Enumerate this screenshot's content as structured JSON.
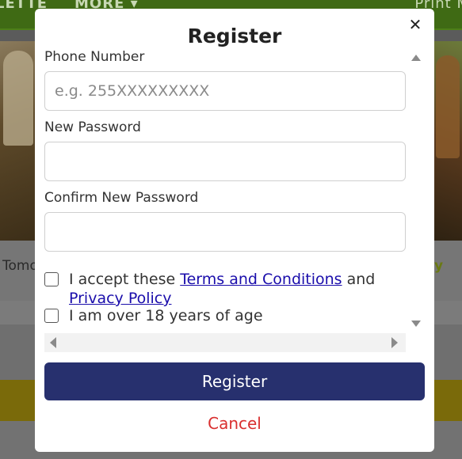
{
  "background": {
    "nav_items": [
      "LETTE",
      "MORE ▾",
      "Print M"
    ],
    "tile_label_left": "Tomo",
    "tile_label_right": "y"
  },
  "modal": {
    "title": "Register",
    "close_glyph": "✕",
    "fields": {
      "phone": {
        "label": "Phone Number",
        "placeholder": "e.g. 255XXXXXXXXX",
        "value": ""
      },
      "new_password": {
        "label": "New Password",
        "placeholder": "",
        "value": ""
      },
      "confirm_password": {
        "label": "Confirm New Password",
        "placeholder": "",
        "value": ""
      }
    },
    "terms": {
      "prefix": "I accept these ",
      "terms_link": "Terms and Conditions",
      "middle": " and ",
      "privacy_link": "Privacy Policy",
      "checked": false
    },
    "age": {
      "label": "I am over 18 years of age",
      "checked": false
    },
    "register_button": "Register",
    "cancel_link": "Cancel",
    "colors": {
      "primary_button": "#27306e",
      "cancel_text": "#d92f2f",
      "link": "#1a0dab"
    }
  }
}
